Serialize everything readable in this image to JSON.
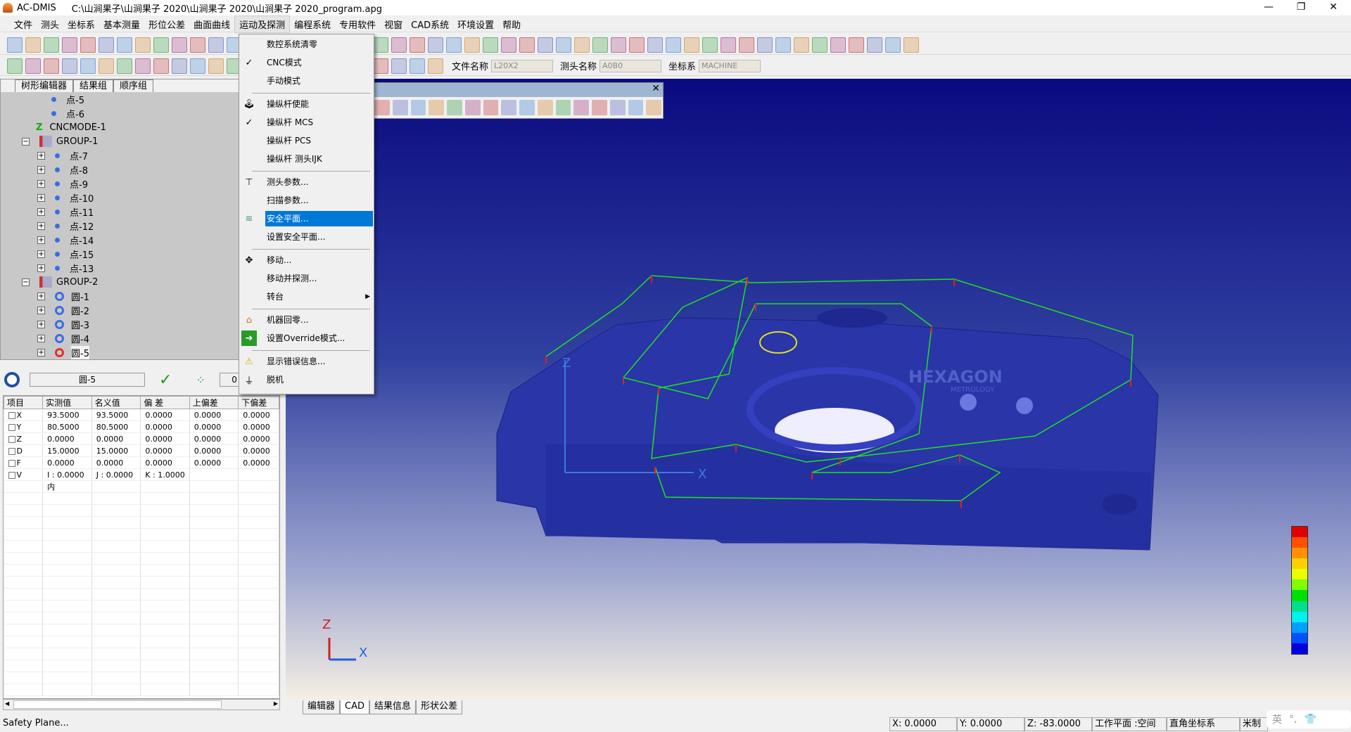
{
  "window": {
    "app": "AC-DMIS",
    "path": "C:\\山涧果子\\山涧果子  2020\\山涧果子  2020\\山涧果子  2020_program.apg",
    "minimize": "—",
    "maximize": "❐",
    "close": "✕"
  },
  "menu": [
    "文件",
    "测头",
    "坐标系",
    "基本测量",
    "形位公差",
    "曲面曲线",
    "运动及探测",
    "编程系统",
    "专用软件",
    "视窗",
    "CAD系统",
    "环境设置",
    "帮助"
  ],
  "menu_active": "运动及探测",
  "toolbar2_fields": {
    "file_label": "文件名称",
    "file_value": "L20X2",
    "probe_label": "测头名称",
    "probe_value": "A0B0",
    "cs_label": "坐标系",
    "cs_value": "MACHINE"
  },
  "left_tabs": [
    "树形编辑器",
    "结果组",
    "顺序组"
  ],
  "tree": [
    {
      "label": "点-5",
      "type": "point-link"
    },
    {
      "label": "点-6",
      "type": "point-link"
    },
    {
      "label": "CNCMODE-1",
      "type": "cncmode"
    },
    {
      "label": "GROUP-1",
      "type": "group"
    },
    {
      "label": "点-7",
      "type": "point"
    },
    {
      "label": "点-8",
      "type": "point"
    },
    {
      "label": "点-9",
      "type": "point"
    },
    {
      "label": "点-10",
      "type": "point"
    },
    {
      "label": "点-11",
      "type": "point"
    },
    {
      "label": "点-12",
      "type": "point"
    },
    {
      "label": "点-14",
      "type": "point"
    },
    {
      "label": "点-15",
      "type": "point"
    },
    {
      "label": "点-13",
      "type": "point"
    },
    {
      "label": "GROUP-2",
      "type": "group"
    },
    {
      "label": "圆-1",
      "type": "circle"
    },
    {
      "label": "圆-2",
      "type": "circle"
    },
    {
      "label": "圆-3",
      "type": "circle"
    },
    {
      "label": "圆-4",
      "type": "circle"
    },
    {
      "label": "圆-5",
      "type": "circle-selected"
    }
  ],
  "record": {
    "feature": "圆-5",
    "count": "0"
  },
  "table": {
    "headers": [
      "项目",
      "实测值",
      "名义值",
      "偏 差",
      "上偏差",
      "下偏差"
    ],
    "rows": [
      [
        "X",
        "93.5000",
        "93.5000",
        "0.0000",
        "0.0000",
        "0.0000"
      ],
      [
        "Y",
        "80.5000",
        "80.5000",
        "0.0000",
        "0.0000",
        "0.0000"
      ],
      [
        "Z",
        "0.0000",
        "0.0000",
        "0.0000",
        "0.0000",
        "0.0000"
      ],
      [
        "D",
        "15.0000",
        "15.0000",
        "0.0000",
        "0.0000",
        "0.0000"
      ],
      [
        "F",
        "0.0000",
        "0.0000",
        "0.0000",
        "0.0000",
        "0.0000"
      ],
      [
        "V",
        "I : 0.0000",
        "J : 0.0000",
        "K : 1.0000",
        "",
        ""
      ]
    ],
    "extra": "内"
  },
  "dropdown": [
    {
      "label": "数控系统清零",
      "icon": ""
    },
    {
      "label": "CNC模式",
      "icon": "check"
    },
    {
      "label": "手动模式",
      "icon": ""
    },
    {
      "label": "操纵杆使能",
      "icon": "joystick"
    },
    {
      "label": "操纵杆 MCS",
      "icon": "check"
    },
    {
      "label": "操纵杆 PCS",
      "icon": ""
    },
    {
      "label": "操纵杆 测头IJK",
      "icon": ""
    },
    {
      "label": "测头参数...",
      "icon": "probe"
    },
    {
      "label": "扫描参数...",
      "icon": ""
    },
    {
      "label": "安全平面...",
      "icon": "layers"
    },
    {
      "label": "设置安全平面...",
      "icon": ""
    },
    {
      "label": "移动...",
      "icon": "move"
    },
    {
      "label": "移动并探测...",
      "icon": ""
    },
    {
      "label": "转台",
      "icon": "submenu"
    },
    {
      "label": "机器回零...",
      "icon": "home"
    },
    {
      "label": "设置Override模式...",
      "icon": "arrow-right"
    },
    {
      "label": "显示错误信息...",
      "icon": "warning"
    },
    {
      "label": "脱机",
      "icon": "offline"
    }
  ],
  "view": {
    "logo": "HEXAGON",
    "logo_sub": "METROLOGY",
    "axis_x": "X",
    "axis_z": "Z",
    "colors": {
      "part": "#2a35a8",
      "path": "#20e020",
      "points": "#e02020"
    }
  },
  "color_scale": [
    "#e00000",
    "#ff5000",
    "#ff9000",
    "#ffd000",
    "#e8ff00",
    "#80ff00",
    "#00e000",
    "#00e090",
    "#00f0f0",
    "#00a0ff",
    "#0050ff",
    "#0000e0"
  ],
  "bottom_tabs": [
    "编辑器",
    "CAD",
    "结果信息",
    "形状公差"
  ],
  "bottom_active": "CAD",
  "status": {
    "left": "Safety Plane...",
    "x": "X: 0.0000",
    "y": "Y: 0.0000",
    "z": "Z: -83.0000",
    "plane": "工作平面 :空间",
    "cs": "直角坐标系",
    "unit": "米制"
  },
  "ime": {
    "lang": "英",
    "punct": "°,"
  }
}
